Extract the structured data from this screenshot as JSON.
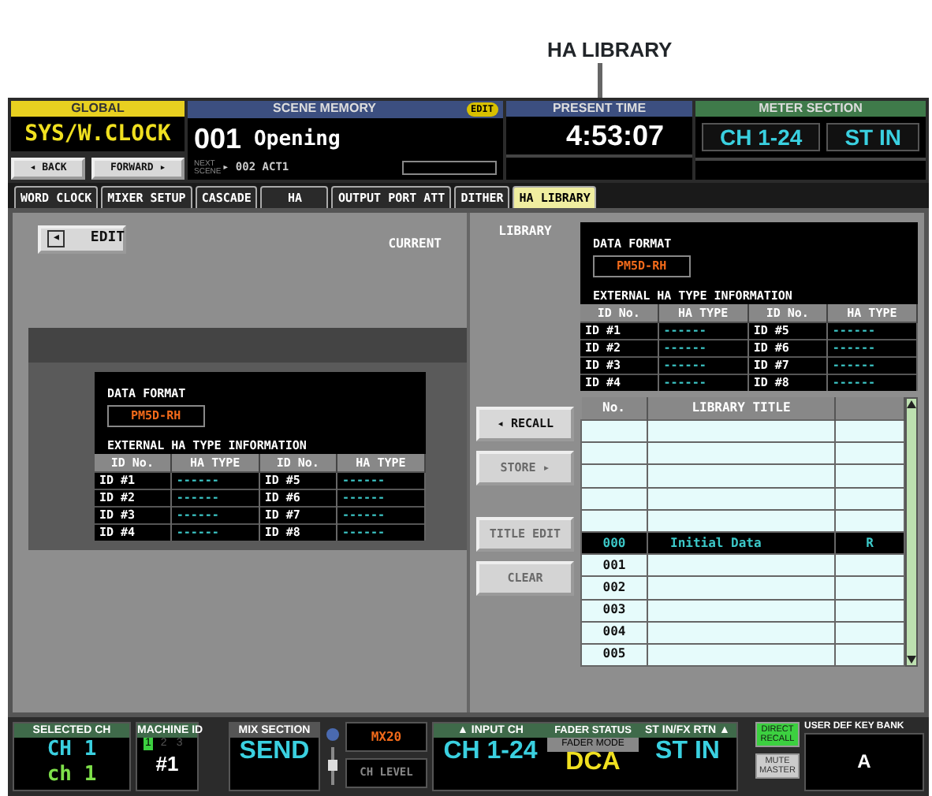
{
  "callout": {
    "label": "HA LIBRARY"
  },
  "global": {
    "header": "GLOBAL",
    "title": "SYS/W.CLOCK",
    "back": "◂ BACK",
    "forward": "FORWARD ▸"
  },
  "scene_memory": {
    "header": "SCENE MEMORY",
    "badge": "EDIT",
    "number": "001",
    "name": "Opening",
    "next_label": "NEXT SCENE",
    "next": "▸ 002 ACT1"
  },
  "present_time": {
    "header": "PRESENT TIME",
    "time": "4:53:07"
  },
  "meter_section": {
    "header": "METER SECTION",
    "buttons": [
      "CH 1-24",
      "ST IN"
    ]
  },
  "tabs": [
    {
      "label": "WORD CLOCK",
      "selected": false
    },
    {
      "label": "MIXER SETUP",
      "selected": false
    },
    {
      "label": "CASCADE",
      "selected": false
    },
    {
      "label": "HA",
      "selected": false
    },
    {
      "label": "OUTPUT PORT ATT",
      "selected": false
    },
    {
      "label": "DITHER",
      "selected": false
    },
    {
      "label": "HA LIBRARY",
      "selected": true
    }
  ],
  "edit_button": {
    "icon": "◂",
    "label": "EDIT"
  },
  "current": {
    "label": "CURRENT",
    "data_format_label": "DATA FORMAT",
    "data_format": "PM5D-RH",
    "info_label": "EXTERNAL HA TYPE INFORMATION",
    "columns": [
      "ID No.",
      "HA TYPE",
      "ID No.",
      "HA TYPE"
    ],
    "rows": [
      [
        "ID #1",
        "------",
        "ID #5",
        "------"
      ],
      [
        "ID #2",
        "------",
        "ID #6",
        "------"
      ],
      [
        "ID #3",
        "------",
        "ID #7",
        "------"
      ],
      [
        "ID #4",
        "------",
        "ID #8",
        "------"
      ]
    ]
  },
  "library": {
    "label": "LIBRARY",
    "data_format_label": "DATA FORMAT",
    "data_format": "PM5D-RH",
    "info_label": "EXTERNAL HA TYPE INFORMATION",
    "columns": [
      "ID No.",
      "HA TYPE",
      "ID No.",
      "HA TYPE"
    ],
    "rows": [
      [
        "ID #1",
        "------",
        "ID #5",
        "------"
      ],
      [
        "ID #2",
        "------",
        "ID #6",
        "------"
      ],
      [
        "ID #3",
        "------",
        "ID #7",
        "------"
      ],
      [
        "ID #4",
        "------",
        "ID #8",
        "------"
      ]
    ]
  },
  "buttons": [
    {
      "label": "◂ RECALL",
      "disabled": false
    },
    {
      "label": "STORE ▸",
      "disabled": true
    },
    {
      "label": "TITLE EDIT",
      "disabled": true
    },
    {
      "label": "CLEAR",
      "disabled": true
    }
  ],
  "library_list": {
    "columns": [
      "No.",
      "LIBRARY TITLE"
    ],
    "rows": [
      {
        "selected": false
      },
      {
        "selected": false
      },
      {
        "selected": false
      },
      {
        "selected": false
      },
      {
        "selected": false
      },
      {
        "no": "000",
        "title": "Initial Data",
        "column_3": "R",
        "selected": true
      },
      {
        "no": "001",
        "selected": false
      },
      {
        "no": "002",
        "selected": false
      },
      {
        "no": "003",
        "selected": false
      },
      {
        "no": "004",
        "selected": false
      },
      {
        "no": "005",
        "selected": false
      }
    ]
  },
  "selected_ch": {
    "header": "SELECTED CH",
    "channel": "CH 1",
    "name": "ch 1"
  },
  "machine_id": {
    "header": "MACHINE ID",
    "indicators": [
      {
        "label": "1",
        "on": true
      },
      {
        "label": "2",
        "on": false
      },
      {
        "label": "3",
        "on": false
      }
    ],
    "value": "#1"
  },
  "mix_section": {
    "header": "MIX SECTION",
    "value": "SEND"
  },
  "mix_bus": "MX20",
  "ch_level": "CH LEVEL",
  "input_ch": {
    "header": "▲ INPUT CH",
    "value": "CH 1-24"
  },
  "fader_status": {
    "header": "FADER STATUS",
    "mode_label": "FADER MODE",
    "value": "DCA"
  },
  "st_in": {
    "header": "ST IN/FX RTN ▲",
    "value": "ST IN"
  },
  "direct_recall": {
    "label": "DIRECT RECALL",
    "on": true
  },
  "mute_master": "MUTE MASTER",
  "user_def": {
    "header": "USER DEF KEY BANK",
    "value": "A"
  }
}
